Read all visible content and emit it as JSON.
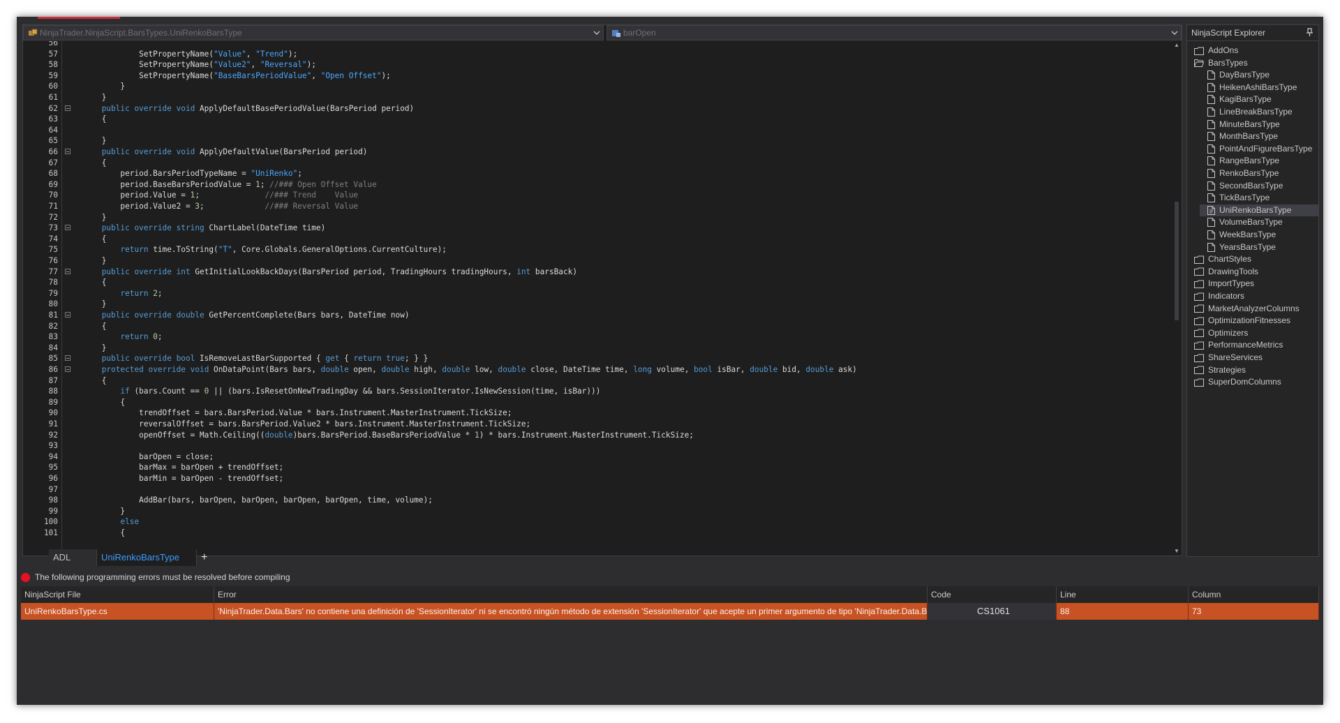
{
  "colors": {
    "accent": "#c8323c",
    "error_row": "#c75223",
    "keyword": "#569cd6",
    "string": "#4aa8ff",
    "comment": "#7f7f7f",
    "selected_tab": "#3e9bff"
  },
  "editor": {
    "nav_type": "NinjaTrader.NinjaScript.BarsTypes.UniRenkoBarsType",
    "nav_member": "barOpen",
    "lines": [
      {
        "n": "56",
        "fold": false,
        "html": ""
      },
      {
        "n": "57",
        "fold": false,
        "html": "            SetPropertyName(<span class=\"str\">\"Value\"</span>, <span class=\"str\">\"Trend\"</span>);"
      },
      {
        "n": "58",
        "fold": false,
        "html": "            SetPropertyName(<span class=\"str\">\"Value2\"</span>, <span class=\"str\">\"Reversal\"</span>);"
      },
      {
        "n": "59",
        "fold": false,
        "html": "            SetPropertyName(<span class=\"str\">\"BaseBarsPeriodValue\"</span>, <span class=\"str\">\"Open Offset\"</span>);"
      },
      {
        "n": "60",
        "fold": false,
        "html": "        }"
      },
      {
        "n": "61",
        "fold": false,
        "html": "    }"
      },
      {
        "n": "62",
        "fold": true,
        "html": "    <span class=\"kw\">public</span> <span class=\"kw\">override</span> <span class=\"kw\">void</span> ApplyDefaultBasePeriodValue(BarsPeriod period)"
      },
      {
        "n": "63",
        "fold": false,
        "html": "    {"
      },
      {
        "n": "64",
        "fold": false,
        "html": ""
      },
      {
        "n": "65",
        "fold": false,
        "html": "    }"
      },
      {
        "n": "66",
        "fold": true,
        "html": "    <span class=\"kw\">public</span> <span class=\"kw\">override</span> <span class=\"kw\">void</span> ApplyDefaultValue(BarsPeriod period)"
      },
      {
        "n": "67",
        "fold": false,
        "html": "    {"
      },
      {
        "n": "68",
        "fold": false,
        "html": "        period.BarsPeriodTypeName = <span class=\"str\">\"UniRenko\"</span>;"
      },
      {
        "n": "69",
        "fold": false,
        "html": "        period.BaseBarsPeriodValue = <span class=\"num\">1</span>; <span class=\"cm\">//### Open Offset Value</span>"
      },
      {
        "n": "70",
        "fold": false,
        "html": "        period.Value = <span class=\"num\">1</span>;              <span class=\"cm\">//### Trend    Value</span>"
      },
      {
        "n": "71",
        "fold": false,
        "html": "        period.Value2 = <span class=\"num\">3</span>;             <span class=\"cm\">//### Reversal Value</span>"
      },
      {
        "n": "72",
        "fold": false,
        "html": "    }"
      },
      {
        "n": "73",
        "fold": true,
        "html": "    <span class=\"kw\">public</span> <span class=\"kw\">override</span> <span class=\"kw\">string</span> ChartLabel(DateTime time)"
      },
      {
        "n": "74",
        "fold": false,
        "html": "    {"
      },
      {
        "n": "75",
        "fold": false,
        "html": "        <span class=\"kw\">return</span> time.ToString(<span class=\"str\">\"T\"</span>, Core.Globals.GeneralOptions.CurrentCulture);"
      },
      {
        "n": "76",
        "fold": false,
        "html": "    }"
      },
      {
        "n": "77",
        "fold": true,
        "html": "    <span class=\"kw\">public</span> <span class=\"kw\">override</span> <span class=\"kw\">int</span> GetInitialLookBackDays(BarsPeriod period, TradingHours tradingHours, <span class=\"kw\">int</span> barsBack)"
      },
      {
        "n": "78",
        "fold": false,
        "html": "    {"
      },
      {
        "n": "79",
        "fold": false,
        "html": "        <span class=\"kw\">return</span> <span class=\"num\">2</span>;"
      },
      {
        "n": "80",
        "fold": false,
        "html": "    }"
      },
      {
        "n": "81",
        "fold": true,
        "html": "    <span class=\"kw\">public</span> <span class=\"kw\">override</span> <span class=\"kw\">double</span> GetPercentComplete(Bars bars, DateTime now)"
      },
      {
        "n": "82",
        "fold": false,
        "html": "    {"
      },
      {
        "n": "83",
        "fold": false,
        "html": "        <span class=\"kw\">return</span> <span class=\"num\">0</span>;"
      },
      {
        "n": "84",
        "fold": false,
        "html": "    }"
      },
      {
        "n": "85",
        "fold": true,
        "html": "    <span class=\"kw\">public</span> <span class=\"kw\">override</span> <span class=\"kw\">bool</span> IsRemoveLastBarSupported { <span class=\"kw\">get</span> { <span class=\"kw\">return</span> <span class=\"kw\">true</span>; } }"
      },
      {
        "n": "86",
        "fold": true,
        "html": "    <span class=\"kw\">protected</span> <span class=\"kw\">override</span> <span class=\"kw\">void</span> OnDataPoint(Bars bars, <span class=\"kw\">double</span> open, <span class=\"kw\">double</span> high, <span class=\"kw\">double</span> low, <span class=\"kw\">double</span> close, DateTime time, <span class=\"kw\">long</span> volume, <span class=\"kw\">bool</span> isBar, <span class=\"kw\">double</span> bid, <span class=\"kw\">double</span> ask)"
      },
      {
        "n": "87",
        "fold": false,
        "html": "    {"
      },
      {
        "n": "88",
        "fold": false,
        "html": "        <span class=\"kw\">if</span> (bars.Count == <span class=\"num\">0</span> || (bars.IsResetOnNewTradingDay &amp;&amp; bars.SessionIterator.IsNewSession(time, isBar)))"
      },
      {
        "n": "89",
        "fold": false,
        "html": "        {"
      },
      {
        "n": "90",
        "fold": false,
        "html": "            trendOffset = bars.BarsPeriod.Value * bars.Instrument.MasterInstrument.TickSize;"
      },
      {
        "n": "91",
        "fold": false,
        "html": "            reversalOffset = bars.BarsPeriod.Value2 * bars.Instrument.MasterInstrument.TickSize;"
      },
      {
        "n": "92",
        "fold": false,
        "html": "            openOffset = Math.Ceiling((<span class=\"kw\">double</span>)bars.BarsPeriod.BaseBarsPeriodValue * <span class=\"num\">1</span>) * bars.Instrument.MasterInstrument.TickSize;"
      },
      {
        "n": "93",
        "fold": false,
        "html": ""
      },
      {
        "n": "94",
        "fold": false,
        "html": "            barOpen = close;"
      },
      {
        "n": "95",
        "fold": false,
        "html": "            barMax = barOpen + trendOffset;"
      },
      {
        "n": "96",
        "fold": false,
        "html": "            barMin = barOpen - trendOffset;"
      },
      {
        "n": "97",
        "fold": false,
        "html": ""
      },
      {
        "n": "98",
        "fold": false,
        "html": "            AddBar(bars, barOpen, barOpen, barOpen, barOpen, time, volume);"
      },
      {
        "n": "99",
        "fold": false,
        "html": "        }"
      },
      {
        "n": "100",
        "fold": false,
        "html": "        <span class=\"kw\">else</span>"
      },
      {
        "n": "101",
        "fold": false,
        "html": "        {"
      }
    ]
  },
  "explorer": {
    "title": "NinjaScript Explorer",
    "items": [
      {
        "label": "AddOns",
        "kind": "folder",
        "depth": 0,
        "selected": false
      },
      {
        "label": "BarsTypes",
        "kind": "folder-open",
        "depth": 0,
        "selected": false
      },
      {
        "label": "DayBarsType",
        "kind": "file",
        "depth": 1,
        "selected": false
      },
      {
        "label": "HeikenAshiBarsType",
        "kind": "file",
        "depth": 1,
        "selected": false
      },
      {
        "label": "KagiBarsType",
        "kind": "file",
        "depth": 1,
        "selected": false
      },
      {
        "label": "LineBreakBarsType",
        "kind": "file",
        "depth": 1,
        "selected": false
      },
      {
        "label": "MinuteBarsType",
        "kind": "file",
        "depth": 1,
        "selected": false
      },
      {
        "label": "MonthBarsType",
        "kind": "file",
        "depth": 1,
        "selected": false
      },
      {
        "label": "PointAndFigureBarsType",
        "kind": "file",
        "depth": 1,
        "selected": false
      },
      {
        "label": "RangeBarsType",
        "kind": "file",
        "depth": 1,
        "selected": false
      },
      {
        "label": "RenkoBarsType",
        "kind": "file",
        "depth": 1,
        "selected": false
      },
      {
        "label": "SecondBarsType",
        "kind": "file",
        "depth": 1,
        "selected": false
      },
      {
        "label": "TickBarsType",
        "kind": "file",
        "depth": 1,
        "selected": false
      },
      {
        "label": "UniRenkoBarsType",
        "kind": "file-edit",
        "depth": 1,
        "selected": true
      },
      {
        "label": "VolumeBarsType",
        "kind": "file",
        "depth": 1,
        "selected": false
      },
      {
        "label": "WeekBarsType",
        "kind": "file",
        "depth": 1,
        "selected": false
      },
      {
        "label": "YearsBarsType",
        "kind": "file",
        "depth": 1,
        "selected": false
      },
      {
        "label": "ChartStyles",
        "kind": "folder",
        "depth": 0,
        "selected": false
      },
      {
        "label": "DrawingTools",
        "kind": "folder",
        "depth": 0,
        "selected": false
      },
      {
        "label": "ImportTypes",
        "kind": "folder",
        "depth": 0,
        "selected": false
      },
      {
        "label": "Indicators",
        "kind": "folder",
        "depth": 0,
        "selected": false
      },
      {
        "label": "MarketAnalyzerColumns",
        "kind": "folder",
        "depth": 0,
        "selected": false
      },
      {
        "label": "OptimizationFitnesses",
        "kind": "folder",
        "depth": 0,
        "selected": false
      },
      {
        "label": "Optimizers",
        "kind": "folder",
        "depth": 0,
        "selected": false
      },
      {
        "label": "PerformanceMetrics",
        "kind": "folder",
        "depth": 0,
        "selected": false
      },
      {
        "label": "ShareServices",
        "kind": "folder",
        "depth": 0,
        "selected": false
      },
      {
        "label": "Strategies",
        "kind": "folder",
        "depth": 0,
        "selected": false
      },
      {
        "label": "SuperDomColumns",
        "kind": "folder",
        "depth": 0,
        "selected": false
      }
    ]
  },
  "tabs": {
    "adl": "ADL",
    "active": "UniRenkoBarsType",
    "add": "+"
  },
  "errors": {
    "banner": "The following programming errors must be resolved before compiling",
    "columns": {
      "file": "NinjaScript File",
      "error": "Error",
      "code": "Code",
      "line": "Line",
      "column": "Column"
    },
    "rows": [
      {
        "file": "UniRenkoBarsType.cs",
        "error": "'NinjaTrader.Data.Bars' no contiene una definición de 'SessionIterator' ni se encontró ningún método de extensión 'SessionIterator' que acepte un primer argumento de tipo 'NinjaTrader.Data.Bars'",
        "code": "CS1061",
        "line": "88",
        "column": "73"
      }
    ]
  }
}
